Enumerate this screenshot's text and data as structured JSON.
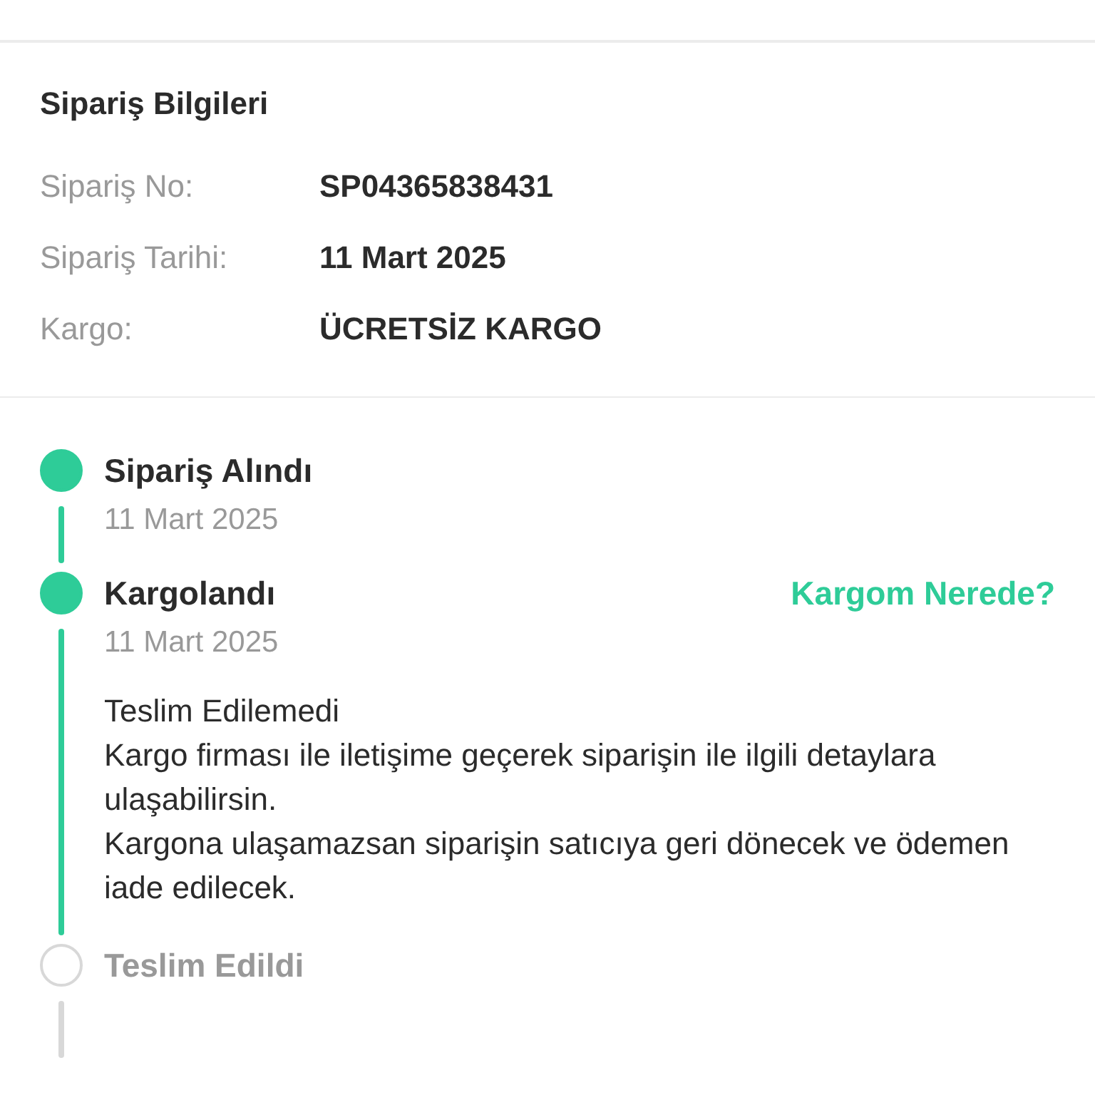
{
  "order_info": {
    "title": "Sipariş Bilgileri",
    "rows": [
      {
        "label": "Sipariş No:",
        "value": "SP04365838431"
      },
      {
        "label": "Sipariş Tarihi:",
        "value": "11 Mart 2025"
      },
      {
        "label": "Kargo:",
        "value": "ÜCRETSİZ KARGO"
      }
    ]
  },
  "timeline": [
    {
      "title": "Sipariş Alındı",
      "done": true,
      "date": "11 Mart 2025"
    },
    {
      "title": "Kargolandı",
      "done": true,
      "date": "11 Mart 2025",
      "link": "Kargom Nerede?",
      "note": [
        "Teslim Edilemedi",
        "Kargo firması ile iletişime geçerek siparişin ile ilgili detaylara ulaşabilirsin.",
        "Kargona ulaşamazsan siparişin satıcıya geri dönecek ve ödemen iade edilecek."
      ]
    },
    {
      "title": "Teslim Edildi",
      "done": false
    }
  ]
}
